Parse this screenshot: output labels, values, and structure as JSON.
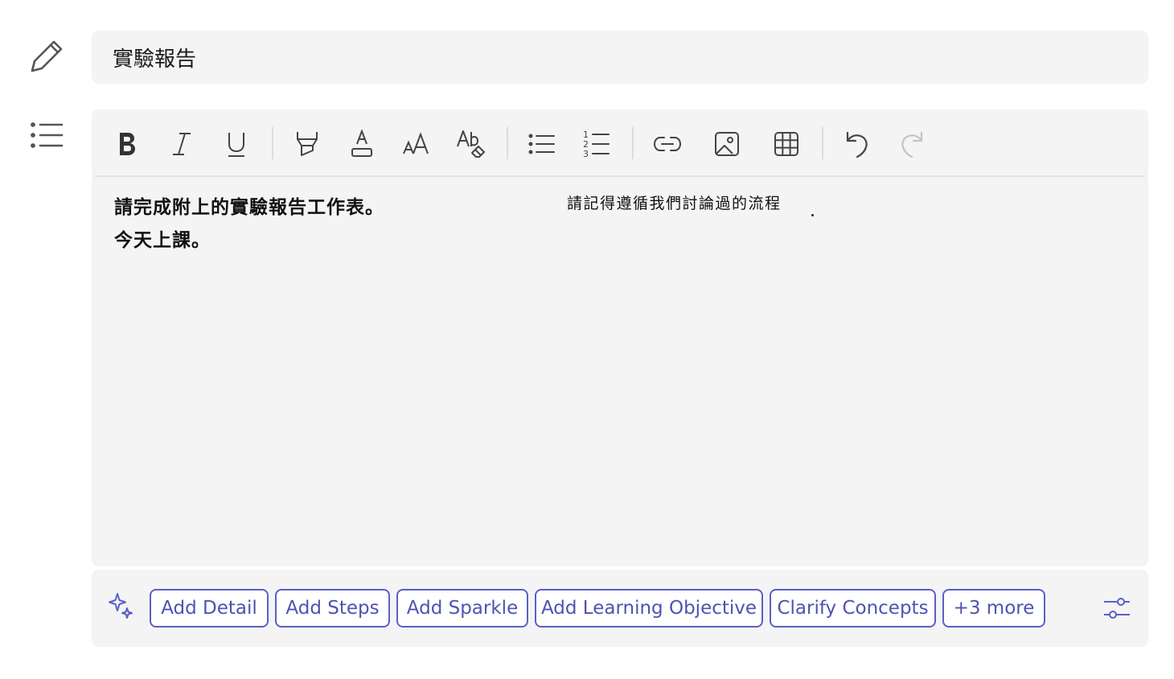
{
  "title": {
    "value": "實驗報告"
  },
  "toolbar": {
    "buttons": [
      {
        "name": "bold",
        "label": "B"
      },
      {
        "name": "italic",
        "label": "I"
      },
      {
        "name": "underline",
        "label": "U"
      },
      {
        "name": "highlight",
        "label": "highlight"
      },
      {
        "name": "font-color",
        "label": "A"
      },
      {
        "name": "font-size",
        "label": "AA"
      },
      {
        "name": "clear-format",
        "label": "Ab"
      },
      {
        "name": "bulleted-list",
        "label": "bullets"
      },
      {
        "name": "numbered-list",
        "label": "numbering"
      },
      {
        "name": "link",
        "label": "link"
      },
      {
        "name": "image",
        "label": "image"
      },
      {
        "name": "table",
        "label": "table"
      },
      {
        "name": "undo",
        "label": "undo"
      },
      {
        "name": "redo",
        "label": "redo"
      }
    ]
  },
  "editor": {
    "lines": [
      "請完成附上的實驗報告工作表。",
      "今天上課。"
    ],
    "note": "請記得遵循我們討論過的流程"
  },
  "suggestions": {
    "chips": [
      "Add Detail",
      "Add Steps",
      "Add Sparkle",
      "Add Learning Objective",
      "Clarify Concepts",
      "+3 more"
    ]
  },
  "colors": {
    "accent": "#5b5fc7",
    "accent_text": "#4f52b2",
    "panel_bg": "#f4f4f4",
    "icon": "#444444"
  }
}
